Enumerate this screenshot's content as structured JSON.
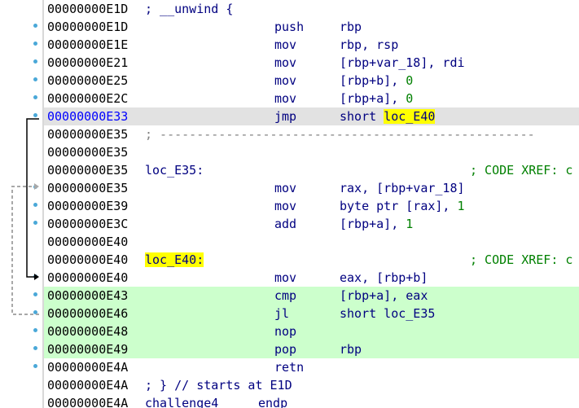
{
  "rows": [
    {
      "addr": "00000000E1D",
      "after": "; __unwind {",
      "mn": "",
      "op": "",
      "cmt": ""
    },
    {
      "addr": "00000000E1D",
      "after": "",
      "mn": "push",
      "op": "rbp",
      "cmt": ""
    },
    {
      "addr": "00000000E1E",
      "after": "",
      "mn": "mov",
      "op": "rbp, rsp",
      "cmt": ""
    },
    {
      "addr": "00000000E21",
      "after": "",
      "mn": "mov",
      "op": "[rbp+var_18], rdi",
      "cmt": ""
    },
    {
      "addr": "00000000E25",
      "after": "",
      "mn": "mov",
      "op": "[rbp+b], 0",
      "cmt": ""
    },
    {
      "addr": "00000000E2C",
      "after": "",
      "mn": "mov",
      "op": "[rbp+a], 0",
      "cmt": ""
    },
    {
      "addr": "00000000E33",
      "after": "",
      "mn": "jmp",
      "op": "short loc_E40",
      "cmt": ""
    },
    {
      "addr": "00000000E35",
      "after": "; ---------------------------------------------------",
      "mn": "",
      "op": "",
      "cmt": ""
    },
    {
      "addr": "00000000E35",
      "after": "",
      "mn": "",
      "op": "",
      "cmt": ""
    },
    {
      "addr": "00000000E35",
      "after": "loc_E35:",
      "mn": "",
      "op": "",
      "cmt": "; CODE XREF: c"
    },
    {
      "addr": "00000000E35",
      "after": "",
      "mn": "mov",
      "op": "rax, [rbp+var_18]",
      "cmt": ""
    },
    {
      "addr": "00000000E39",
      "after": "",
      "mn": "mov",
      "op": "byte ptr [rax], 1",
      "cmt": ""
    },
    {
      "addr": "00000000E3C",
      "after": "",
      "mn": "add",
      "op": "[rbp+a], 1",
      "cmt": ""
    },
    {
      "addr": "00000000E40",
      "after": "",
      "mn": "",
      "op": "",
      "cmt": ""
    },
    {
      "addr": "00000000E40",
      "after": "loc_E40:",
      "mn": "",
      "op": "",
      "cmt": "; CODE XREF: c"
    },
    {
      "addr": "00000000E40",
      "after": "",
      "mn": "mov",
      "op": "eax, [rbp+b]",
      "cmt": ""
    },
    {
      "addr": "00000000E43",
      "after": "",
      "mn": "cmp",
      "op": "[rbp+a], eax",
      "cmt": ""
    },
    {
      "addr": "00000000E46",
      "after": "",
      "mn": "jl",
      "op": "short loc_E35",
      "cmt": ""
    },
    {
      "addr": "00000000E48",
      "after": "",
      "mn": "nop",
      "op": "",
      "cmt": ""
    },
    {
      "addr": "00000000E49",
      "after": "",
      "mn": "pop",
      "op": "rbp",
      "cmt": ""
    },
    {
      "addr": "00000000E4A",
      "after": "",
      "mn": "retn",
      "op": "",
      "cmt": ""
    },
    {
      "addr": "00000000E4A",
      "after": "; } // starts at E1D",
      "mn": "",
      "op": "",
      "cmt": ""
    },
    {
      "addr": "00000000E4A",
      "after": "challenge4",
      "mn": "endp",
      "op": "",
      "cmt": ""
    }
  ],
  "colors": {
    "selected_row_bg": "#e2e2e2",
    "highlight_green": "#ccffcc",
    "highlight_yellow": "#ffff00",
    "comment_green": "#008000",
    "gutter_dot": "#4aa8d8"
  }
}
